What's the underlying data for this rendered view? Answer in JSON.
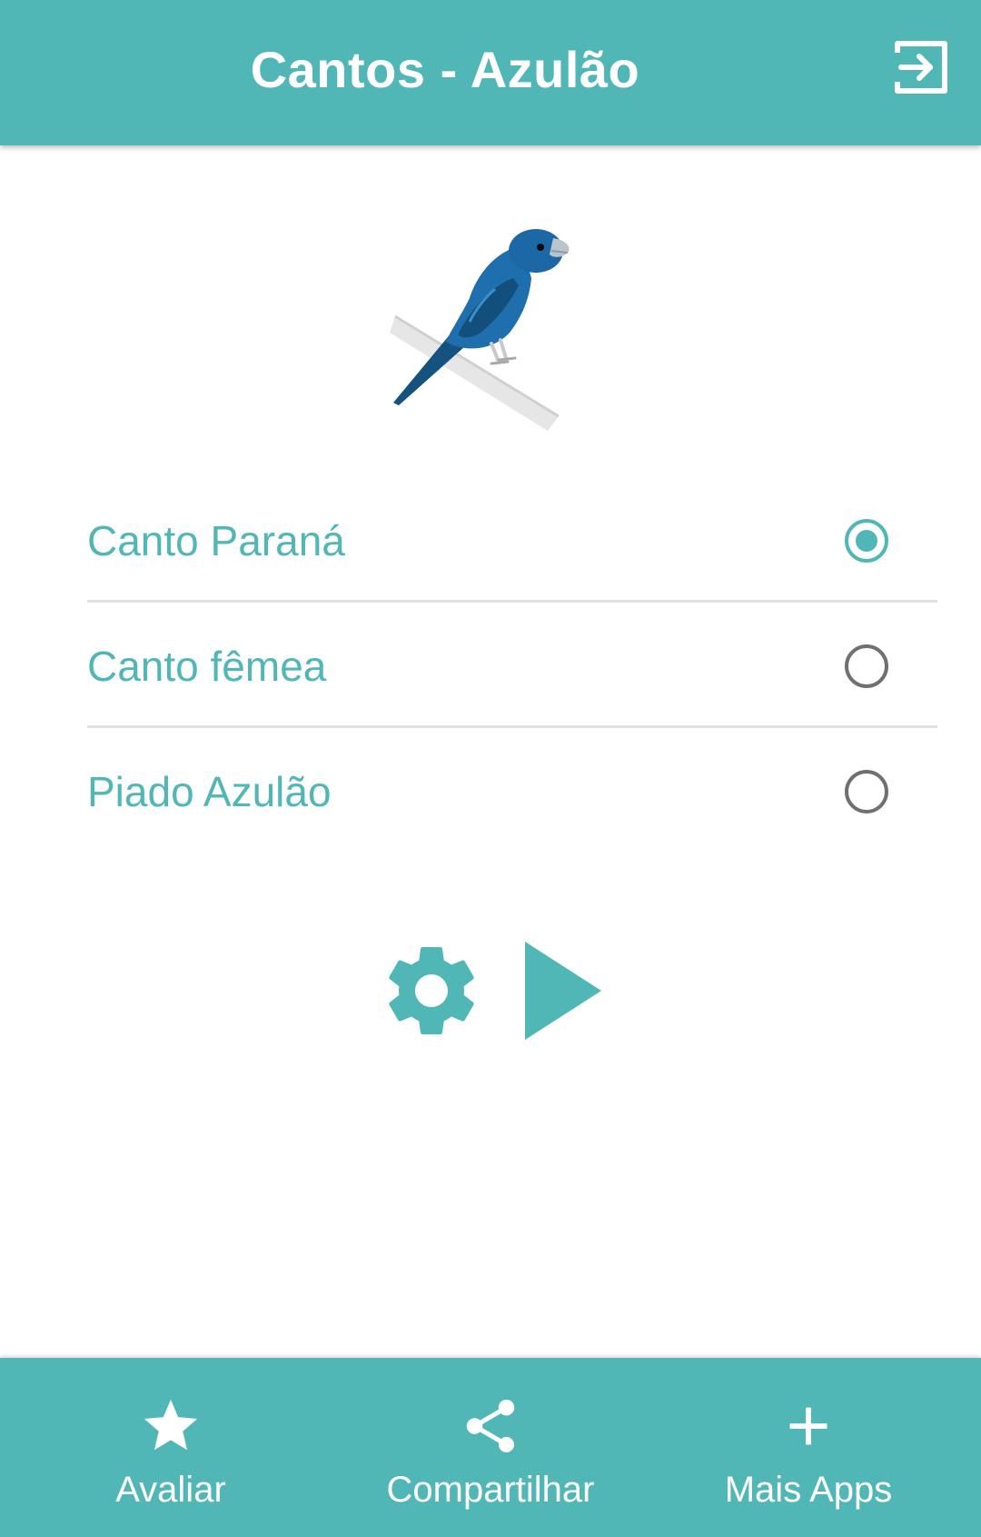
{
  "appbar": {
    "title": "Cantos - Azulão",
    "exit_icon": "exit-to-app-icon"
  },
  "bird_image": {
    "icon": "bird-icon",
    "color": "#1f6fae"
  },
  "options": [
    {
      "label": "Canto Paraná",
      "selected": true
    },
    {
      "label": "Canto fêmea",
      "selected": false
    },
    {
      "label": "Piado Azulão",
      "selected": false
    }
  ],
  "controls": {
    "settings_icon": "gear-icon",
    "play_icon": "play-icon"
  },
  "bottom_nav": [
    {
      "label": "Avaliar",
      "icon": "star-icon"
    },
    {
      "label": "Compartilhar",
      "icon": "share-icon"
    },
    {
      "label": "Mais Apps",
      "icon": "plus-icon"
    }
  ],
  "colors": {
    "primary": "#51b7b6",
    "radio_unchecked": "#707070",
    "divider": "#e1e1e1",
    "background": "#ffffff"
  }
}
